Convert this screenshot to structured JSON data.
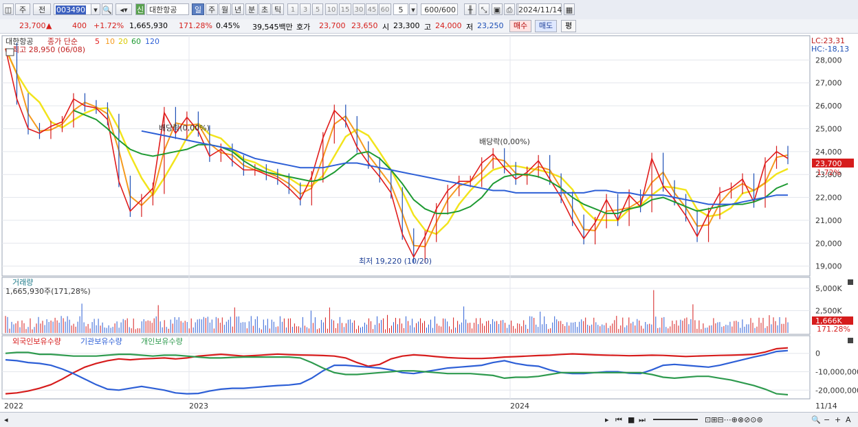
{
  "toolbar": {
    "period_type": "주",
    "range_label": "전",
    "stock_code": "003490",
    "stock_badge": "신",
    "stock_name": "대한항공",
    "periods": [
      "일",
      "주",
      "월",
      "년",
      "분",
      "초",
      "틱"
    ],
    "active_period": "일",
    "intervals": [
      "1",
      "3",
      "5",
      "10",
      "15",
      "30",
      "45",
      "60"
    ],
    "interval_value": "5",
    "count": "600",
    "count_total": "/600",
    "date": "2024/11/14"
  },
  "info": {
    "price": "23,700",
    "arrow": "▲",
    "change": "400",
    "change_pct": "+1.72%",
    "volume": "1,665,930",
    "volume_pct": "171.28%",
    "turnover": "0.45%",
    "amount": "39,545백만",
    "quote_label": "호가",
    "ask": "23,700",
    "bid": "23,650",
    "open_label": "시",
    "open": "23,300",
    "high_label": "고",
    "high": "24,000",
    "low_label": "저",
    "low": "23,250",
    "buy_btn": "매수",
    "sell_btn": "매도",
    "eval_btn": "평"
  },
  "price_panel": {
    "stock_name": "대한항공",
    "ma_label": "종가 단순",
    "ma_periods": [
      "5",
      "10",
      "20",
      "60",
      "120"
    ],
    "ma_colors": [
      "#e01b1b",
      "#f59a1e",
      "#f2e41c",
      "#1e9a32",
      "#2d5fd6"
    ],
    "high_note": "최고 28,950 (06/08)",
    "low_note": "최저 19,220 (10/20)",
    "div_note_1": "배당락(0,00%)",
    "div_note_2": "배당락(0,00%)",
    "lc": "LC:23,31",
    "hc": "HC:-18,13",
    "last_price_tag": "23,700",
    "last_pct_tag": "1.72%",
    "y_ticks": [
      "28,000",
      "27,000",
      "26,000",
      "25,000",
      "24,000",
      "23,000",
      "22,000",
      "21,000",
      "20,000",
      "19,000"
    ]
  },
  "volume_panel": {
    "title": "거래량",
    "value": "1,665,930주(171,28%)",
    "y_ticks": [
      "5,000K",
      "2,500K"
    ],
    "last_tag": "1,666K",
    "last_pct": "171.28%"
  },
  "holding_panel": {
    "legend": [
      "외국인보유수량",
      "기관보유수량",
      "개인보유수량"
    ],
    "colors": [
      "#d61c1c",
      "#2d5fd6",
      "#2e9a4e"
    ],
    "y_ticks": [
      "0",
      "-10,000,000",
      "-20,000,000"
    ]
  },
  "x_axis": {
    "labels": [
      "2022",
      "2023",
      "2024"
    ],
    "last_date": "11/14"
  },
  "chart_data": {
    "type": "line",
    "title": "대한항공",
    "xlabel": "",
    "ylabel": "",
    "ylim": [
      18600,
      29000
    ],
    "y_ticks": [
      19000,
      20000,
      21000,
      22000,
      23000,
      24000,
      25000,
      26000,
      27000,
      28000
    ],
    "x_labels": [
      "2022",
      "2023",
      "2024"
    ],
    "series": [
      {
        "name": "종가",
        "values": [
          28500,
          26300,
          25000,
          24800,
          25100,
          25300,
          26300,
          26000,
          25900,
          25400,
          22700,
          21400,
          21900,
          22400,
          25700,
          24800,
          25500,
          24900,
          23800,
          24100,
          23600,
          23200,
          23200,
          23000,
          22800,
          22400,
          21900,
          22900,
          24600,
          25800,
          25300,
          24200,
          23500,
          22900,
          22200,
          20400,
          19400,
          20300,
          21500,
          22300,
          22700,
          22700,
          23500,
          23900,
          23300,
          22800,
          23100,
          23600,
          22800,
          22000,
          21000,
          20200,
          20900,
          21900,
          21000,
          22100,
          21600,
          23700,
          22500,
          21900,
          21200,
          20300,
          21300,
          22200,
          22400,
          22800,
          21800,
          23500,
          24000,
          23700
        ]
      },
      {
        "name": "120",
        "values": [
          null,
          null,
          null,
          null,
          null,
          null,
          null,
          null,
          null,
          null,
          null,
          null,
          24900,
          24800,
          24700,
          24600,
          24500,
          24400,
          24300,
          24200,
          24100,
          23900,
          23700,
          23600,
          23500,
          23400,
          23300,
          23300,
          23300,
          23400,
          23500,
          23500,
          23400,
          23300,
          23200,
          23100,
          23000,
          22900,
          22800,
          22700,
          22600,
          22500,
          22400,
          22300,
          22300,
          22200,
          22200,
          22200,
          22200,
          22200,
          22200,
          22200,
          22300,
          22300,
          22200,
          22200,
          22100,
          22100,
          22100,
          22000,
          21900,
          21800,
          21700,
          21700,
          21700,
          21800,
          21900,
          22000,
          22100,
          22100
        ]
      },
      {
        "name": "60",
        "values": [
          null,
          null,
          null,
          null,
          null,
          null,
          25800,
          25600,
          25400,
          25000,
          24500,
          24100,
          23900,
          23800,
          23900,
          24000,
          24100,
          24300,
          24300,
          24200,
          24000,
          23600,
          23300,
          23100,
          23000,
          22900,
          22800,
          22700,
          22800,
          23100,
          23500,
          23900,
          24000,
          23700,
          23200,
          22600,
          21900,
          21500,
          21300,
          21300,
          21400,
          21600,
          22000,
          22600,
          22900,
          23000,
          23000,
          22900,
          22700,
          22400,
          22000,
          21700,
          21500,
          21300,
          21300,
          21500,
          21600,
          21900,
          22000,
          21800,
          21600,
          21400,
          21500,
          21600,
          21700,
          21700,
          21800,
          22000,
          22400,
          22600
        ]
      }
    ],
    "volume_chart": {
      "type": "bar",
      "ylim": [
        0,
        6000
      ],
      "y_ticks": [
        2500,
        5000
      ],
      "last_value_k": 1666
    },
    "holding_chart": {
      "type": "line",
      "ylim": [
        -24000000,
        4000000
      ],
      "y_ticks": [
        0,
        -10000000,
        -20000000
      ],
      "series": [
        {
          "name": "외국인보유수량",
          "values": [
            -22000000,
            -21500000,
            -20500000,
            -19000000,
            -17000000,
            -14000000,
            -10500000,
            -7500000,
            -5500000,
            -4000000,
            -3000000,
            -3500000,
            -3000000,
            -2800000,
            -2500000,
            -3000000,
            -2500000,
            -1500000,
            -1000000,
            -500000,
            -1000000,
            -1500000,
            -1200000,
            -800000,
            -400000,
            -700000,
            -900000,
            -1000000,
            -1200000,
            -1500000,
            -2500000,
            -5000000,
            -7000000,
            -6000000,
            -3000000,
            -1500000,
            -800000,
            -1200000,
            -1800000,
            -2300000,
            -2600000,
            -2800000,
            -2800000,
            -2500000,
            -2000000,
            -1800000,
            -1500000,
            -1200000,
            -1000000,
            -600000,
            -300000,
            -500000,
            -800000,
            -1000000,
            -1100000,
            -1300000,
            -1200000,
            -1000000,
            -1100000,
            -1400000,
            -1700000,
            -1500000,
            -1300000,
            -1100000,
            -1000000,
            -800000,
            -500000,
            700000,
            2500000,
            3000000
          ]
        },
        {
          "name": "기관보유수량",
          "values": [
            -3500000,
            -4000000,
            -5000000,
            -5500000,
            -6500000,
            -8500000,
            -11000000,
            -14000000,
            -17000000,
            -19500000,
            -20000000,
            -19000000,
            -18000000,
            -19000000,
            -20000000,
            -21500000,
            -22000000,
            -21800000,
            -20500000,
            -19500000,
            -19000000,
            -19000000,
            -18500000,
            -18000000,
            -17500000,
            -17200000,
            -16500000,
            -13500000,
            -9500000,
            -6500000,
            -6500000,
            -7000000,
            -7500000,
            -8000000,
            -9000000,
            -10500000,
            -11000000,
            -10000000,
            -9000000,
            -8000000,
            -7500000,
            -7000000,
            -6500000,
            -5000000,
            -4000000,
            -5500000,
            -6500000,
            -7000000,
            -9000000,
            -10500000,
            -11000000,
            -11000000,
            -10500000,
            -10000000,
            -10000000,
            -10800000,
            -11000000,
            -9000000,
            -6500000,
            -6000000,
            -6500000,
            -7000000,
            -7500000,
            -6500000,
            -5000000,
            -3500000,
            -2000000,
            -700000,
            1000000,
            1500000
          ]
        },
        {
          "name": "개인보유수량",
          "values": [
            0,
            500000,
            500000,
            -500000,
            -500000,
            -1000000,
            -1500000,
            -1500000,
            -1500000,
            -1000000,
            -500000,
            -500000,
            -1000000,
            -1500000,
            -1000000,
            -1000000,
            -1500000,
            -2000000,
            -2500000,
            -2500000,
            -2200000,
            -2000000,
            -2000000,
            -2000000,
            -2000000,
            -2000000,
            -2500000,
            -5000000,
            -8000000,
            -10500000,
            -11500000,
            -11500000,
            -11000000,
            -10500000,
            -10000000,
            -9500000,
            -9500000,
            -10000000,
            -10500000,
            -11000000,
            -11000000,
            -11000000,
            -11500000,
            -12000000,
            -13500000,
            -13000000,
            -13000000,
            -12500000,
            -11500000,
            -10500000,
            -10500000,
            -10500000,
            -10500000,
            -10500000,
            -10500000,
            -10500000,
            -10500000,
            -11500000,
            -13000000,
            -13500000,
            -13000000,
            -12500000,
            -12500000,
            -13500000,
            -14500000,
            -16000000,
            -17500000,
            -19500000,
            -22000000,
            -22500000
          ]
        }
      ]
    }
  }
}
